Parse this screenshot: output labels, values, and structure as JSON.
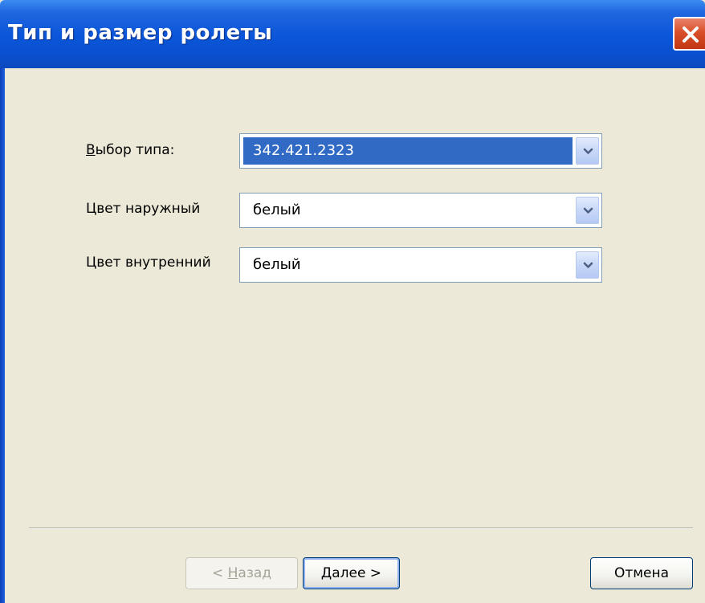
{
  "window": {
    "title": "Тип и размер ролеты"
  },
  "fields": [
    {
      "label_accel": "В",
      "label_rest": "ыбор типа:",
      "value": "342.421.2323",
      "selected": true
    },
    {
      "label": "Цвет наружный",
      "value": "белый",
      "selected": false
    },
    {
      "label": "Цвет внутренний",
      "value": "белый",
      "selected": false
    }
  ],
  "buttons": {
    "back": {
      "prefix": "< ",
      "accel": "Н",
      "rest": "азад",
      "enabled": false
    },
    "next": {
      "accel": "Д",
      "rest": "алее >",
      "enabled": true
    },
    "cancel": {
      "label": "Отмена",
      "enabled": true
    }
  },
  "colors": {
    "titlebar": "#0a55d8",
    "dialog_bg": "#ece9d8",
    "selection": "#316ac5",
    "close_button": "#d94f2a"
  },
  "icons": {
    "close": "close-x-icon",
    "dropdown": "chevron-down-icon"
  }
}
